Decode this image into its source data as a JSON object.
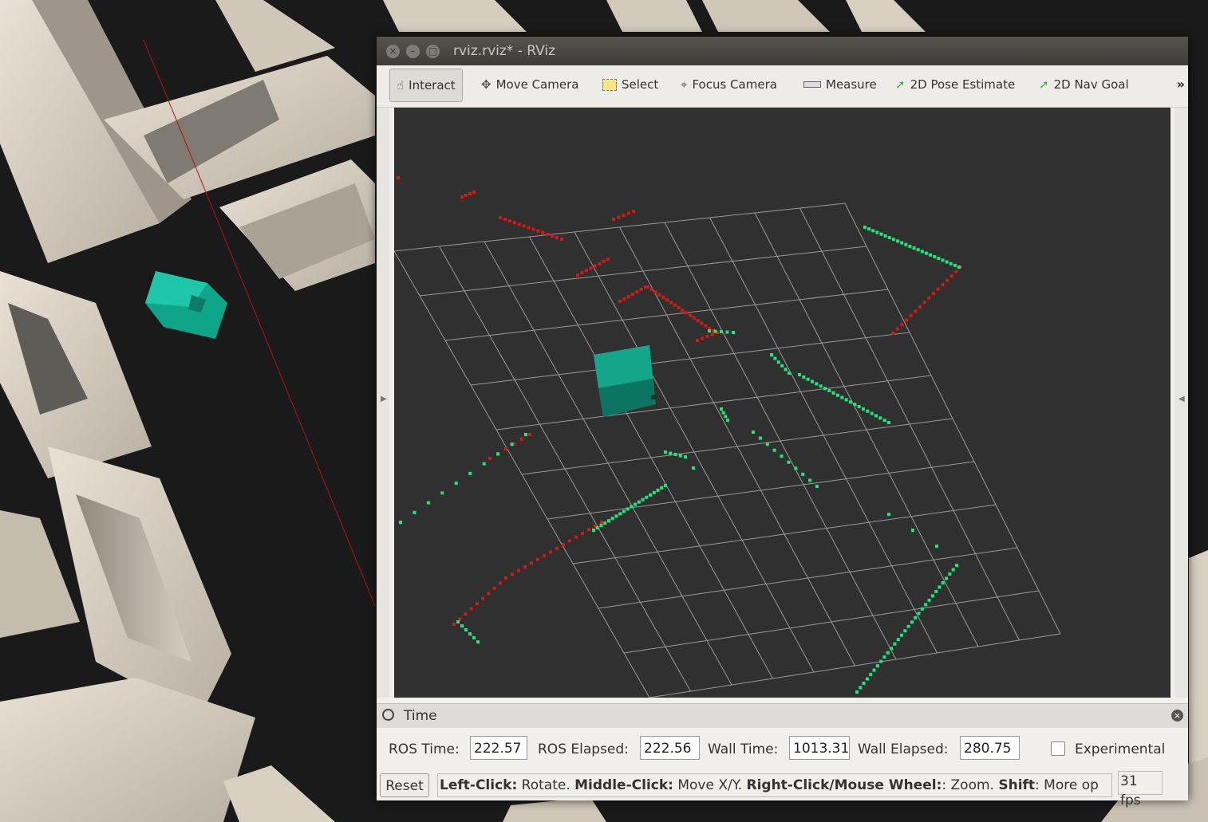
{
  "window": {
    "title": "rviz.rviz* - RViz"
  },
  "toolbar": {
    "tools": [
      {
        "label": "Interact",
        "icon": "hand-pointer-icon",
        "active": true
      },
      {
        "label": "Move Camera",
        "icon": "move-camera-icon"
      },
      {
        "label": "Select",
        "icon": "select-box-icon"
      },
      {
        "label": "Focus Camera",
        "icon": "focus-crosshair-icon"
      },
      {
        "label": "Measure",
        "icon": "ruler-icon"
      },
      {
        "label": "2D Pose Estimate",
        "icon": "green-arrow-icon"
      },
      {
        "label": "2D Nav Goal",
        "icon": "green-arrow-icon"
      }
    ],
    "overflow": "»"
  },
  "time_panel": {
    "title": "Time",
    "ros_time_label": "ROS Time:",
    "ros_time": "222.57",
    "ros_elapsed_label": "ROS Elapsed:",
    "ros_elapsed": "222.56",
    "wall_time_label": "Wall Time:",
    "wall_time": "1013.31",
    "wall_elapsed_label": "Wall Elapsed:",
    "wall_elapsed": "280.75",
    "experimental_label": "Experimental"
  },
  "status": {
    "reset_label": "Reset",
    "hint": [
      {
        "b": "Left-Click:",
        "t": " Rotate. "
      },
      {
        "b": "Middle-Click:",
        "t": " Move X/Y. "
      },
      {
        "b": "Right-Click/Mouse Wheel:",
        "t": ": Zoom. "
      },
      {
        "b": "Shift",
        "t": ": More op"
      }
    ],
    "fps": "31 fps"
  },
  "colors": {
    "scan_green": "#1ee87a",
    "scan_red": "#d41a14",
    "robot": "#12a88a",
    "grid": "#9a9a9a"
  }
}
